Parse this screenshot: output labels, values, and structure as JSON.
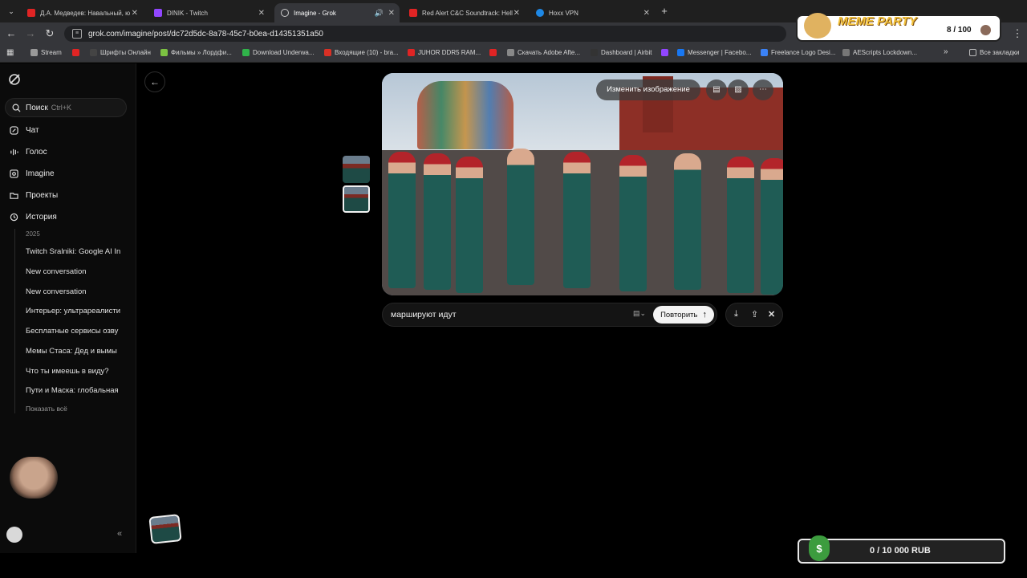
{
  "browser": {
    "tabs": [
      {
        "title": "Д.А. Медведев: Навальный, ю",
        "icon_color": "#e02424"
      },
      {
        "title": "DINIK - Twitch",
        "icon_color": "#9146ff"
      },
      {
        "title": "Imagine - Grok",
        "icon_color": "#cccccc",
        "active": true
      },
      {
        "title": "Red Alert C&C Soundtrack: Hell",
        "icon_color": "#e02424"
      },
      {
        "title": "Hoxx VPN",
        "icon_color": "#1e88e5"
      }
    ],
    "new_tab": "+",
    "url": "grok.com/imagine/post/dc72d5dc-8a78-45c7-b0ea-d14351351a50",
    "bookmarks": [
      {
        "label": "Stream",
        "color": "#999999"
      },
      {
        "label": "",
        "color": "#e02424"
      },
      {
        "label": "Шрифты Онлайн",
        "color": "#444444"
      },
      {
        "label": "Фильмы » Лордфи...",
        "color": "#7cc242"
      },
      {
        "label": "Download Underwa...",
        "color": "#30b34a"
      },
      {
        "label": "Входящие (10) - bra...",
        "color": "#d93025"
      },
      {
        "label": "JUHOR DDR5 RAM...",
        "color": "#e02424"
      },
      {
        "label": "",
        "color": "#e02424"
      },
      {
        "label": "Скачать Adobe Afte...",
        "color": "#888888"
      },
      {
        "label": "Dashboard | Airbit",
        "color": "#333333"
      },
      {
        "label": "",
        "color": "#9146ff"
      },
      {
        "label": "Messenger | Facebo...",
        "color": "#1877f2"
      },
      {
        "label": "Freelance Logo Desi...",
        "color": "#3b82f6"
      },
      {
        "label": "AEScripts Lockdown...",
        "color": "#777777"
      }
    ],
    "bookmarks_more": "»",
    "all_bookmarks": "Все закладки"
  },
  "sidebar": {
    "search_label": "Поиск",
    "search_shortcut": "Ctrl+K",
    "nav": [
      {
        "label": "Чат",
        "icon": "chat-icon"
      },
      {
        "label": "Голос",
        "icon": "voice-icon"
      },
      {
        "label": "Imagine",
        "icon": "image-icon"
      },
      {
        "label": "Проекты",
        "icon": "folder-icon"
      },
      {
        "label": "История",
        "icon": "history-icon"
      }
    ],
    "history_year": "2025",
    "history": [
      "Twitch Sralniki: Google AI In",
      "New conversation",
      "New conversation",
      "Интерьер: ультрареалисти",
      "Бесплатные сервисы озву",
      "Мемы Стаса: Дед и вымы",
      "Что ты имеешь в виду?",
      "Пути и Маска: глобальная"
    ],
    "show_all": "Показать всё"
  },
  "viewer": {
    "edit_image": "Изменить изображение",
    "prompt": "маршируют идут",
    "repeat": "Повторить"
  },
  "overlays": {
    "meme_title": "MEME PARTY",
    "meme_count": "8 / 100",
    "rub_text": "0 / 10 000 RUB",
    "rub_symbol": "$"
  }
}
